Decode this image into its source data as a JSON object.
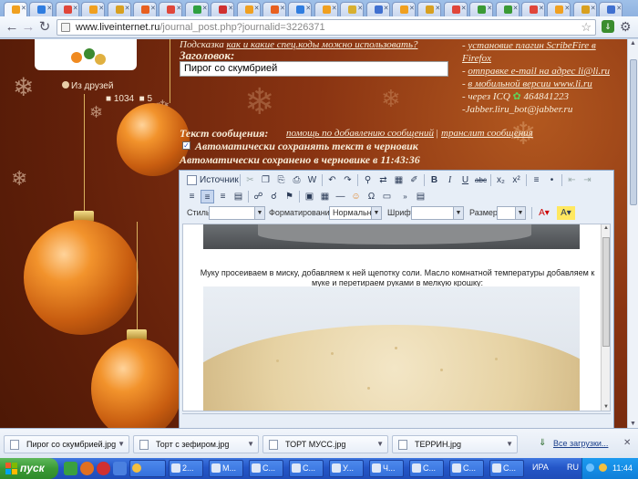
{
  "browser": {
    "url_domain": "www.liveinternet.ru",
    "url_path": "/journal_post.php?journalid=3226371",
    "tab_favicons": [
      "#f0a020",
      "#2f7de0",
      "#e0463a",
      "#f0a020",
      "#d8a020",
      "#e86020",
      "#e0463a",
      "#2fa040",
      "#d03030",
      "#f0a020",
      "#e86020",
      "#2f7de0",
      "#f0a020",
      "#d8b030",
      "#4070d0",
      "#f0a020",
      "#d8a020",
      "#e0463a",
      "#3a9a35",
      "#3a9a35",
      "#e0463a",
      "#f0a020",
      "#d8a020",
      "#4070d0"
    ]
  },
  "sidebar": {
    "friends_label": "Из друзей",
    "stat_posts": "1034",
    "stat_comments": "5"
  },
  "post_form": {
    "hint_prefix": "Подсказка",
    "hint_link": "как и какие спец.коды можно использовать?",
    "title_label": "Заголовок:",
    "title_value": "Пирог со скумбрией",
    "message_label": "Текст сообщения:",
    "message_help_link": "помощь по добавлению сообщений",
    "separator": "|",
    "translit_link": "транслит сообщения",
    "autosave_checked": true,
    "autosave_label": "Автоматически сохранять текст в черновик",
    "autosaved_status": "Автоматически сохранено в черновике в 11:43:36"
  },
  "right_column": {
    "line1_prefix": "-",
    "line1_link": "установие плагин ScribeFire в Firefox",
    "line2_prefix": "-",
    "line2_link": "отправке e-mail на адрес li@li.ru",
    "line3_prefix": "-",
    "line3_link": "в мобильной версии www.li.ru",
    "line4": "- через ICQ",
    "icq_number": "464841223",
    "line5": "-Jabber.liru_bot@jabber.ru"
  },
  "editor": {
    "source_button_label": "Источник",
    "style_label": "Стиль",
    "format_label": "Форматирование",
    "format_value": "Нормальн...",
    "font_label": "Шрифт",
    "size_label": "Размер",
    "content_text": "Муку просеиваем в миску, добавляем к ней щепотку соли. Масло комнатной температуры добавляем к муке и перетираем руками в мелкую крошку:"
  },
  "downloads": {
    "items": [
      "Пирог со скумбрией.jpg",
      "Торт с зефиром.jpg",
      "ТОРТ МУСС.jpg",
      "ТЕРРИН.jpg"
    ],
    "all_label": "Все загрузки..."
  },
  "taskbar": {
    "start_label": "пуск",
    "tasks": [
      "2...",
      "M...",
      "C...",
      "C...",
      "У...",
      "Ч...",
      "C...",
      "C...",
      "C..."
    ],
    "tray_app": "ИРА",
    "lang": "RU",
    "clock": "11:44"
  },
  "colors": {
    "page_bg": "#7a2a0e",
    "accent_text": "#f7ecd8",
    "taskbar": "#2456c8",
    "start_green": "#3a9a35"
  }
}
